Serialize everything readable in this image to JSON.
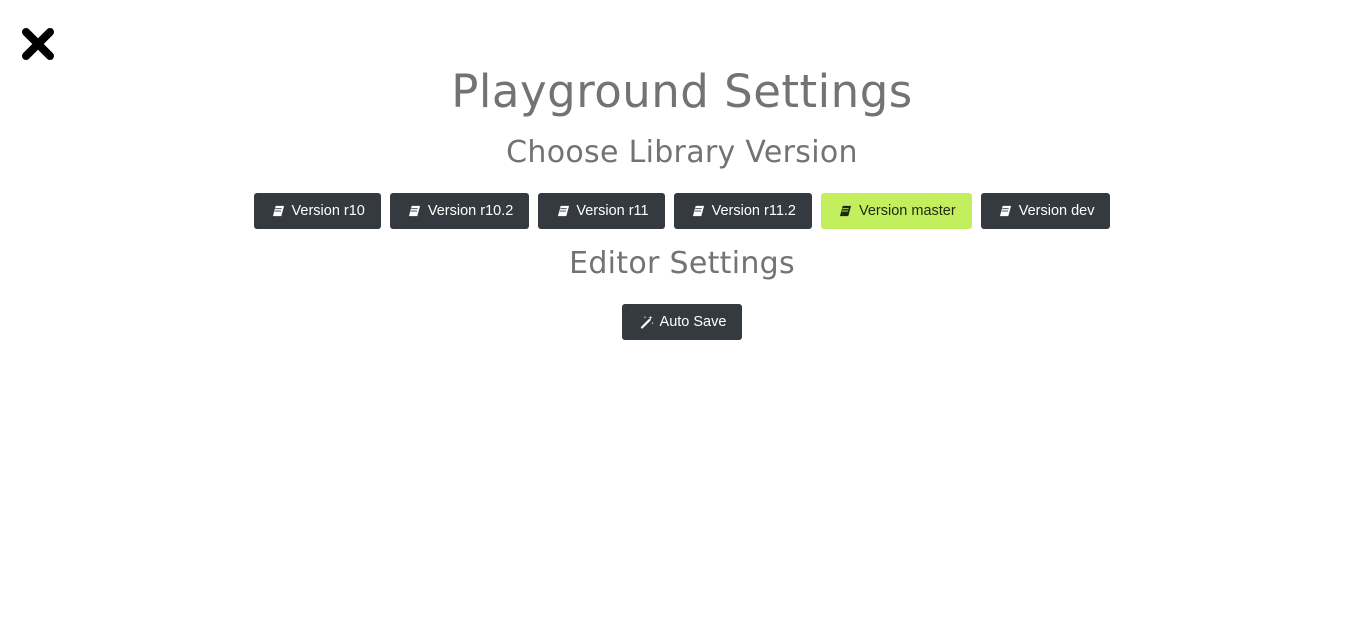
{
  "header": {
    "close_icon": "close-icon",
    "title": "Playground Settings"
  },
  "library": {
    "heading": "Choose Library Version",
    "icon": "book-icon",
    "accent_active_color": "#c3ef5f",
    "button_color": "#343a40",
    "versions": [
      {
        "label": "Version r10",
        "active": false
      },
      {
        "label": "Version r10.2",
        "active": false
      },
      {
        "label": "Version r11",
        "active": false
      },
      {
        "label": "Version r11.2",
        "active": false
      },
      {
        "label": "Version master",
        "active": true
      },
      {
        "label": "Version dev",
        "active": false
      }
    ]
  },
  "editor": {
    "heading": "Editor Settings",
    "auto_save_label": "Auto Save",
    "auto_save_icon": "magic-wand-icon"
  }
}
